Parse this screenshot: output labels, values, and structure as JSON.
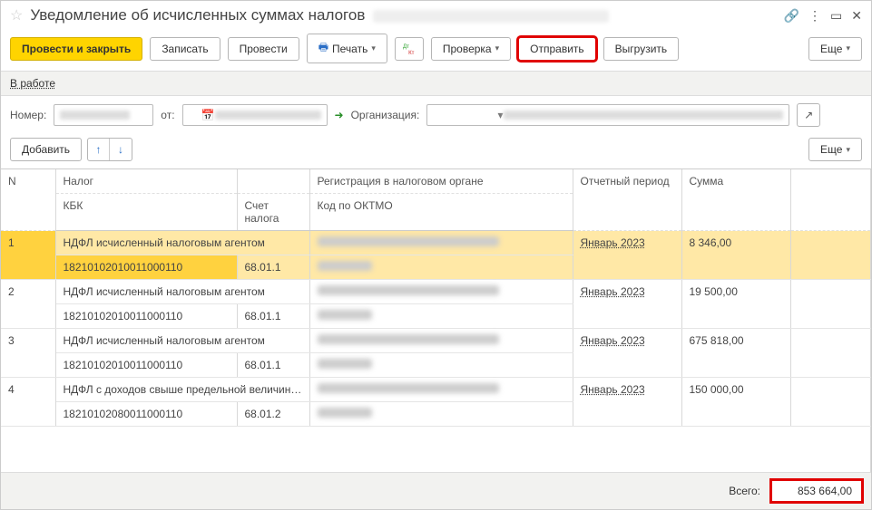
{
  "title": "Уведомление об исчисленных суммах налогов",
  "toolbar": {
    "post_close": "Провести и закрыть",
    "save": "Записать",
    "post": "Провести",
    "print": "Печать",
    "check": "Проверка",
    "send": "Отправить",
    "export": "Выгрузить",
    "more": "Еще"
  },
  "status": {
    "label": "В работе"
  },
  "form": {
    "nomer_label": "Номер:",
    "ot_label": "от:",
    "org_label": "Организация:"
  },
  "row2": {
    "add": "Добавить",
    "more": "Еще"
  },
  "headers": {
    "n": "N",
    "nalog": "Налог",
    "kbk": "КБК",
    "schet": "Счет налога",
    "reg": "Регистрация в налоговом органе",
    "oktmo": "Код по ОКТМО",
    "period": "Отчетный период",
    "summa": "Сумма"
  },
  "rows": [
    {
      "n": "1",
      "nalog": "НДФЛ исчисленный налоговым агентом",
      "kbk": "18210102010011000110",
      "schet": "68.01.1",
      "period": "Январь 2023",
      "summa": "8 346,00"
    },
    {
      "n": "2",
      "nalog": "НДФЛ исчисленный налоговым агентом",
      "kbk": "18210102010011000110",
      "schet": "68.01.1",
      "period": "Январь 2023",
      "summa": "19 500,00"
    },
    {
      "n": "3",
      "nalog": "НДФЛ исчисленный налоговым агентом",
      "kbk": "18210102010011000110",
      "schet": "68.01.1",
      "period": "Январь 2023",
      "summa": "675 818,00"
    },
    {
      "n": "4",
      "nalog": "НДФЛ с доходов свыше предельной величин…",
      "kbk": "18210102080011000110",
      "schet": "68.01.2",
      "period": "Январь 2023",
      "summa": "150 000,00"
    }
  ],
  "footer": {
    "total_label": "Всего:",
    "total_value": "853 664,00"
  }
}
